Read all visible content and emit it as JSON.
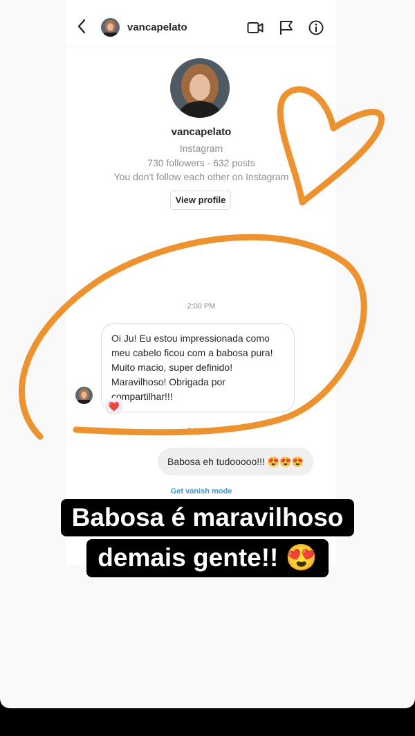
{
  "header": {
    "username": "vancapelato"
  },
  "profile": {
    "name": "vancapelato",
    "platform": "Instagram",
    "stats": "730 followers · 632 posts",
    "relation": "You don't follow each other on Instagram",
    "view_profile_label": "View profile"
  },
  "conversation": {
    "time_1": "2:00 PM",
    "incoming_message": "Oi Ju! Eu estou impressionada como meu cabelo ficou com a babosa pura! Muito macio, super definido! Maravilhoso! Obrigada por compartilhar!!!",
    "reaction": "❤️",
    "time_2": "2:00 PM",
    "outgoing_message": "Babosa eh tudooooo!!! 😍😍😍",
    "vanish_mode_label": "Get vanish mode"
  },
  "caption": {
    "line1": "Babosa é maravilhoso",
    "line2": "demais gente!! 😍"
  },
  "colors": {
    "drawing": "#F0922B",
    "link": "#3897f0"
  }
}
